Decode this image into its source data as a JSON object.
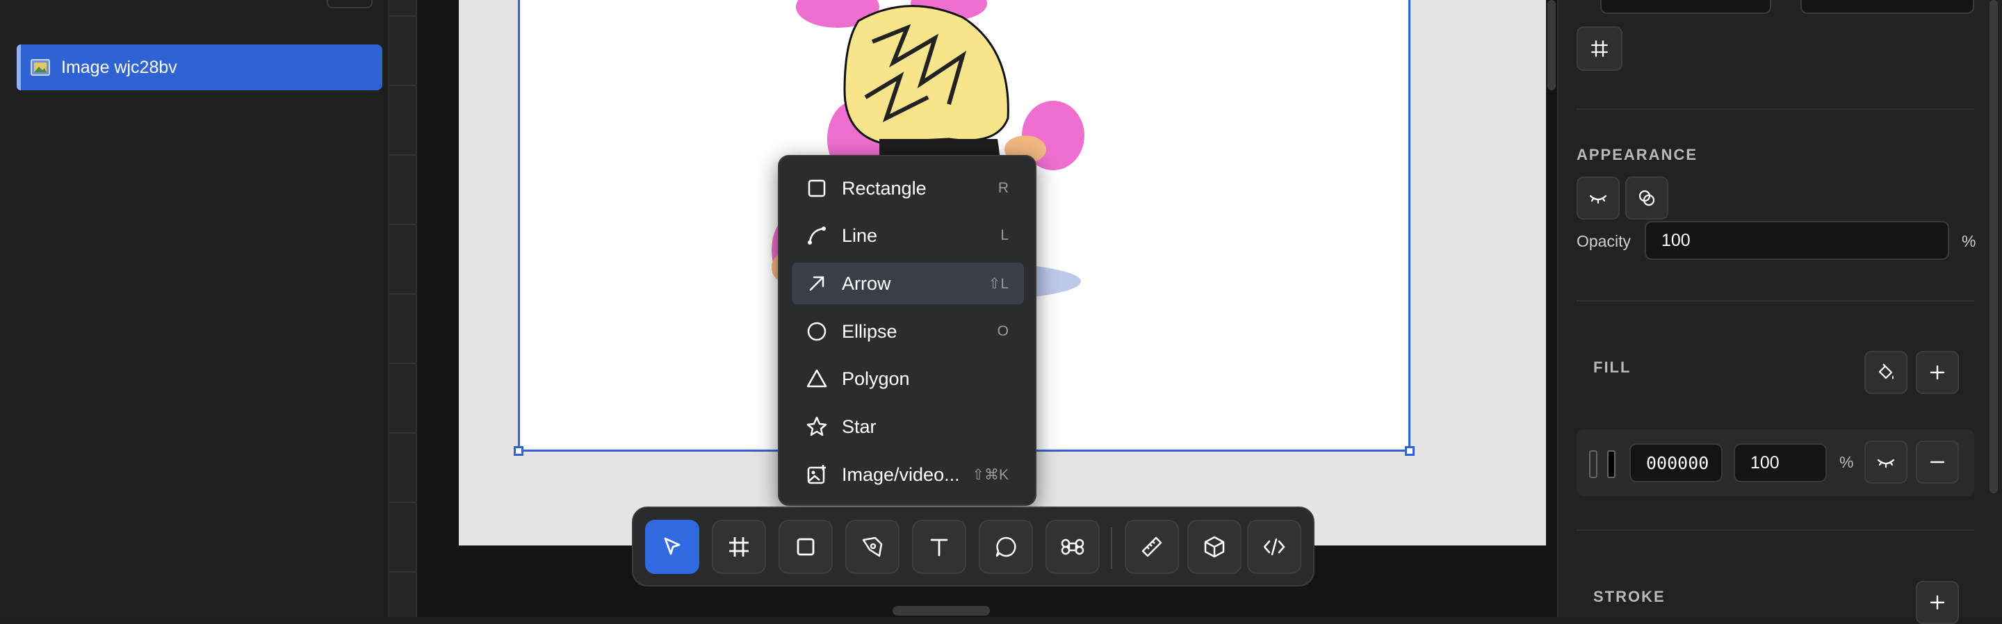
{
  "layers": {
    "items": [
      {
        "label": "Image wjc28bv",
        "selected": true
      }
    ]
  },
  "shape_menu": {
    "items": [
      {
        "label": "Rectangle",
        "shortcut": "R",
        "icon": "square-icon"
      },
      {
        "label": "Line",
        "shortcut": "L",
        "icon": "curve-line-icon"
      },
      {
        "label": "Arrow",
        "shortcut": "⇧L",
        "icon": "arrow-up-right-icon",
        "highlighted": true
      },
      {
        "label": "Ellipse",
        "shortcut": "O",
        "icon": "circle-icon"
      },
      {
        "label": "Polygon",
        "shortcut": "",
        "icon": "triangle-icon"
      },
      {
        "label": "Star",
        "shortcut": "",
        "icon": "star-icon"
      },
      {
        "label": "Image/video...",
        "shortcut": "⇧⌘K",
        "icon": "image-icon"
      }
    ]
  },
  "toolbar": {
    "tools": [
      {
        "name": "select",
        "icon": "cursor-icon",
        "active": true
      },
      {
        "name": "frame",
        "icon": "hash-frame-icon"
      },
      {
        "name": "shape",
        "icon": "square-icon"
      },
      {
        "name": "pen",
        "icon": "pen-icon"
      },
      {
        "name": "text",
        "icon": "text-icon"
      },
      {
        "name": "comment",
        "icon": "comment-icon"
      },
      {
        "name": "component",
        "icon": "command-icon"
      },
      {
        "name": "measure",
        "icon": "ruler-icon"
      },
      {
        "name": "3d",
        "icon": "cube-icon"
      },
      {
        "name": "code",
        "icon": "code-icon"
      }
    ]
  },
  "properties": {
    "appearance": {
      "title": "APPEARANCE",
      "opacity_label": "Opacity",
      "opacity_value": "100",
      "opacity_unit": "%"
    },
    "fill": {
      "title": "FILL",
      "color_hex": "000000",
      "opacity_value": "100",
      "opacity_unit": "%"
    },
    "stroke": {
      "title": "STROKE"
    }
  },
  "colors": {
    "accent": "#2f63d4",
    "panel": "#222222",
    "canvas": "#141414"
  }
}
